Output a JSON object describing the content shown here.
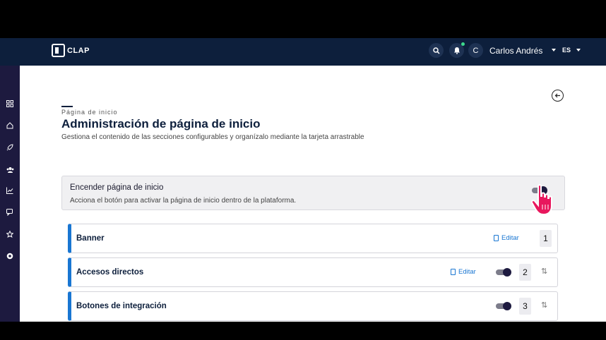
{
  "topbar": {
    "logo_text": "CLAP",
    "user_initial": "C",
    "user_name": "Carlos Andrés",
    "language": "ES",
    "icons": [
      "search-icon",
      "bell-icon"
    ]
  },
  "sidebar": {
    "icons": [
      "grid-icon",
      "home-icon",
      "rocket-icon",
      "users-icon",
      "chart-icon",
      "chat-icon",
      "star-icon",
      "support-icon"
    ]
  },
  "page": {
    "breadcrumb": "Página de inicio",
    "title": "Administración de página de inicio",
    "subtitle": "Gestiona el contenido de las secciones configurables y organízalo mediante la tarjeta arrastrable"
  },
  "power": {
    "title": "Encender página de inicio",
    "description": "Acciona el botón para activar la página de inicio dentro de la plataforma.",
    "enabled": true
  },
  "sections": [
    {
      "name": "Banner",
      "edit_label": "Editar",
      "order": "1",
      "has_toggle": false,
      "enabled": true,
      "sortable": false
    },
    {
      "name": "Accesos directos",
      "edit_label": "Editar",
      "order": "2",
      "has_toggle": true,
      "enabled": true,
      "sortable": true
    },
    {
      "name": "Botones de integración",
      "edit_label": "",
      "order": "3",
      "has_toggle": true,
      "enabled": true,
      "sortable": true
    }
  ],
  "colors": {
    "navy": "#0d1f3c",
    "sidebar": "#1d1a3f",
    "accent_blue": "#1976d2",
    "cursor_pink": "#e8175d"
  }
}
